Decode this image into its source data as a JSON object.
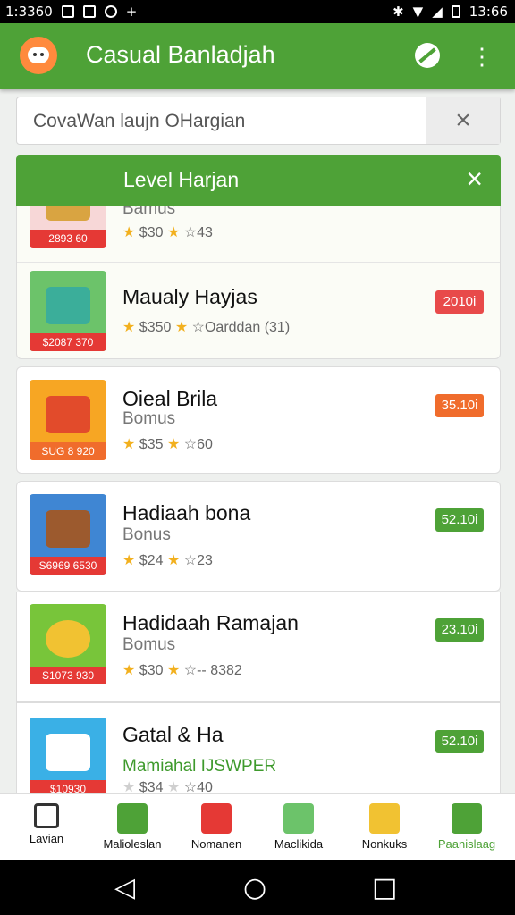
{
  "status": {
    "time": "1:3360",
    "right_time": "13:66"
  },
  "appbar": {
    "title": "Casual Banladjah"
  },
  "search": {
    "value": "CovaWan laujn OHargian",
    "clear": "×"
  },
  "overlay": {
    "title": "Level Harjan",
    "close": "×"
  },
  "cards": [
    {
      "name": "",
      "sub": "Bamus",
      "tag": "2893 60",
      "rating": "$30",
      "extra": "☆43",
      "badge": ""
    },
    {
      "name": "Maualy Hayjas",
      "sub": "",
      "tag": "$2087 370",
      "rating": "$350",
      "extra": "☆Oarddan (31)",
      "badge": "2010i"
    },
    {
      "name": "Oieal Brila",
      "sub": "Bomus",
      "tag": "SUG 8 920",
      "rating": "$35",
      "extra": "☆60",
      "badge": "35.10i"
    },
    {
      "name": "Hadiaah bona",
      "sub": "Bonus",
      "tag": "S6969 6530",
      "rating": "$24",
      "extra": "☆23",
      "badge": "52.10i"
    },
    {
      "name": "Hadidaah Ramajan",
      "sub": "Bomus",
      "tag": "S1073 930",
      "rating": "$30",
      "extra": "☆-- 8382",
      "badge": "23.10i"
    },
    {
      "name": "Gatal & Ha",
      "sub": "Mamiahal IJSWPER",
      "tag": "$10930",
      "rating": "$34",
      "extra": "☆40",
      "badge": "52.10i"
    }
  ],
  "nav": [
    {
      "label": "Lavian"
    },
    {
      "label": "Malioleslan"
    },
    {
      "label": "Nomanen"
    },
    {
      "label": "Maclikida"
    },
    {
      "label": "Nonkuks"
    },
    {
      "label": "Paanislaag"
    }
  ],
  "colors": {
    "green": "#4ea237",
    "red": "#e53935",
    "orange": "#f06c2c"
  }
}
